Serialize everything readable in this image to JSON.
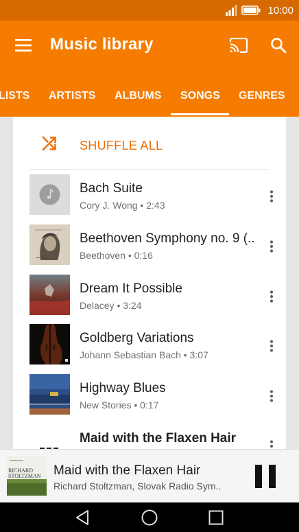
{
  "status_bar": {
    "time": "10:00",
    "signal_icon": "signal-icon",
    "battery_icon": "battery-icon"
  },
  "app_bar": {
    "title": "Music library",
    "menu_icon": "menu-icon",
    "cast_icon": "cast-icon",
    "search_icon": "search-icon"
  },
  "tabs": [
    {
      "label": "LISTS",
      "active": false
    },
    {
      "label": "ARTISTS",
      "active": false
    },
    {
      "label": "ALBUMS",
      "active": false
    },
    {
      "label": "SONGS",
      "active": true
    },
    {
      "label": "GENRES",
      "active": false
    }
  ],
  "shuffle": {
    "label": "SHUFFLE ALL",
    "icon": "shuffle-icon"
  },
  "songs": [
    {
      "title": "Bach Suite",
      "subtitle": "Cory J. Wong • 2:43"
    },
    {
      "title": "Beethoven Symphony no. 9 (..",
      "subtitle": "Beethoven • 0:16"
    },
    {
      "title": "Dream It Possible",
      "subtitle": "Delacey • 3:24"
    },
    {
      "title": "Goldberg Variations",
      "subtitle": "Johann Sebastian Bach • 3:07"
    },
    {
      "title": "Highway Blues",
      "subtitle": "New Stories • 0:17"
    },
    {
      "title": "Maid with the Flaxen Hair",
      "subtitle": ""
    }
  ],
  "now_playing": {
    "title": "Maid with the Flaxen Hair",
    "artist": "Richard Stoltzman, Slovak Radio Sym..",
    "art_text_1": "RICHARD",
    "art_text_2": "STOLTZMAN",
    "pause_icon": "pause-icon"
  },
  "nav": {
    "back_icon": "back-icon",
    "home_icon": "home-icon",
    "recents_icon": "recents-icon"
  },
  "colors": {
    "primary": "#f57c00",
    "status": "#d66a00",
    "accent_text": "#ef6c00"
  }
}
